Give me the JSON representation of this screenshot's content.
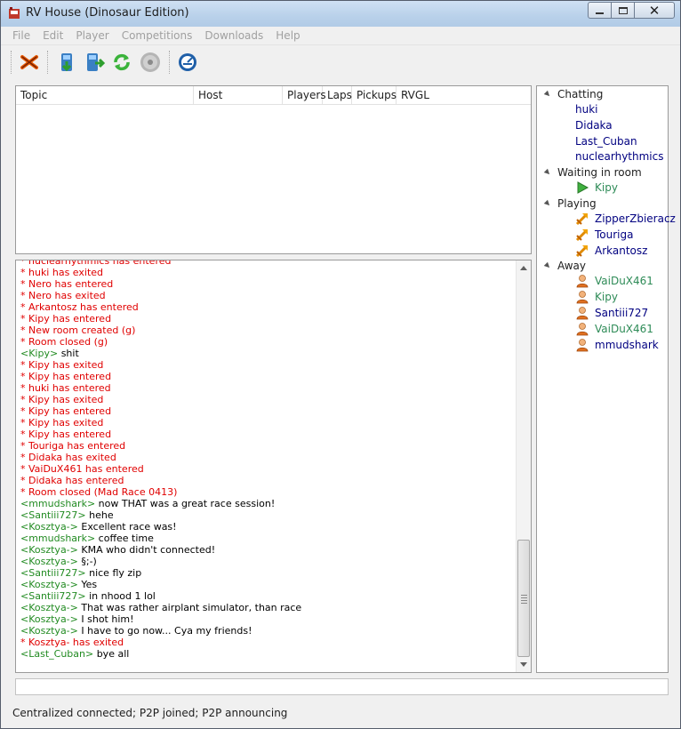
{
  "window": {
    "title": "RV House (Dinosaur Edition)"
  },
  "menu": [
    "File",
    "Edit",
    "Player",
    "Competitions",
    "Downloads",
    "Help"
  ],
  "toolbar": {
    "buttons": [
      "close-icon",
      "host-room-icon",
      "join-room-icon",
      "refresh-icon",
      "disc-icon",
      "radar-icon"
    ]
  },
  "rooms": {
    "columns": [
      "Topic",
      "Host",
      "Players",
      "Laps",
      "Pickups",
      "RVGL"
    ]
  },
  "chat": {
    "lines": [
      {
        "type": "sys",
        "text": "* nuclearhythmics has entered"
      },
      {
        "type": "sys",
        "text": "* huki has exited"
      },
      {
        "type": "sys",
        "text": "* Nero has entered"
      },
      {
        "type": "sys",
        "text": "* Nero has exited"
      },
      {
        "type": "sys",
        "text": "* Arkantosz has entered"
      },
      {
        "type": "sys",
        "text": "* Kipy has entered"
      },
      {
        "type": "sys",
        "text": "* New room created (g)"
      },
      {
        "type": "sys",
        "text": "* Room closed (g)"
      },
      {
        "type": "msg",
        "nick": "Kipy",
        "text": "shit"
      },
      {
        "type": "sys",
        "text": "* Kipy has exited"
      },
      {
        "type": "sys",
        "text": "* Kipy has entered"
      },
      {
        "type": "sys",
        "text": "* huki has entered"
      },
      {
        "type": "sys",
        "text": "* Kipy has exited"
      },
      {
        "type": "sys",
        "text": "* Kipy has entered"
      },
      {
        "type": "sys",
        "text": "* Kipy has exited"
      },
      {
        "type": "sys",
        "text": "* Kipy has entered"
      },
      {
        "type": "sys",
        "text": "* Touriga has entered"
      },
      {
        "type": "sys",
        "text": "* Didaka has exited"
      },
      {
        "type": "sys",
        "text": "* VaiDuX461 has entered"
      },
      {
        "type": "sys",
        "text": "* Didaka has entered"
      },
      {
        "type": "sys",
        "text": "* Room closed (Mad Race 0413)"
      },
      {
        "type": "msg",
        "nick": "mmudshark",
        "text": "now THAT was a great race session!"
      },
      {
        "type": "msg",
        "nick": "Santiii727",
        "text": "hehe"
      },
      {
        "type": "msg",
        "nick": "Kosztya-",
        "text": "Excellent race was!"
      },
      {
        "type": "msg",
        "nick": "mmudshark",
        "text": "coffee time"
      },
      {
        "type": "msg",
        "nick": "Kosztya-",
        "text": "KMA who didn't connected!"
      },
      {
        "type": "msg",
        "nick": "Kosztya-",
        "text": "§;-)"
      },
      {
        "type": "msg",
        "nick": "Santiii727",
        "text": "nice fly zip"
      },
      {
        "type": "msg",
        "nick": "Kosztya-",
        "text": "Yes"
      },
      {
        "type": "msg",
        "nick": "Santiii727",
        "text": "in nhood 1 lol"
      },
      {
        "type": "msg",
        "nick": "Kosztya-",
        "text": "That was rather airplant simulator, than race"
      },
      {
        "type": "msg",
        "nick": "Kosztya-",
        "text": "I shot him!"
      },
      {
        "type": "msg",
        "nick": "Kosztya-",
        "text": "I have to go now... Cya my friends!"
      },
      {
        "type": "sys",
        "text": "* Kosztya- has exited"
      },
      {
        "type": "msg",
        "nick": "Last_Cuban",
        "text": "bye all"
      }
    ]
  },
  "input": {
    "value": ""
  },
  "status": {
    "text": "Centralized connected; P2P joined; P2P announcing"
  },
  "users": {
    "groups": [
      {
        "label": "Chatting",
        "members": [
          {
            "name": "huki",
            "icon": "",
            "color": "#000080"
          },
          {
            "name": "Didaka",
            "icon": "",
            "color": "#000080"
          },
          {
            "name": "Last_Cuban",
            "icon": "",
            "color": "#000080"
          },
          {
            "name": "nuclearhythmics",
            "icon": "",
            "color": "#000080"
          }
        ]
      },
      {
        "label": "Waiting in room",
        "members": [
          {
            "name": "Kipy",
            "icon": "play-icon",
            "color": "#2e8b57"
          }
        ]
      },
      {
        "label": "Playing",
        "members": [
          {
            "name": "ZipperZbieracz",
            "icon": "racing-icon",
            "color": "#000080"
          },
          {
            "name": "Touriga",
            "icon": "racing-icon",
            "color": "#000080"
          },
          {
            "name": "Arkantosz",
            "icon": "racing-icon",
            "color": "#000080"
          }
        ]
      },
      {
        "label": "Away",
        "members": [
          {
            "name": "VaiDuX461",
            "icon": "away-user-icon",
            "color": "#2e8b57"
          },
          {
            "name": "Kipy",
            "icon": "away-user-icon",
            "color": "#2e8b57"
          },
          {
            "name": "Santiii727",
            "icon": "away-user-icon",
            "color": "#000080"
          },
          {
            "name": "VaiDuX461",
            "icon": "away-user-icon",
            "color": "#2e8b57"
          },
          {
            "name": "mmudshark",
            "icon": "away-user-icon",
            "color": "#000080"
          }
        ]
      }
    ]
  }
}
